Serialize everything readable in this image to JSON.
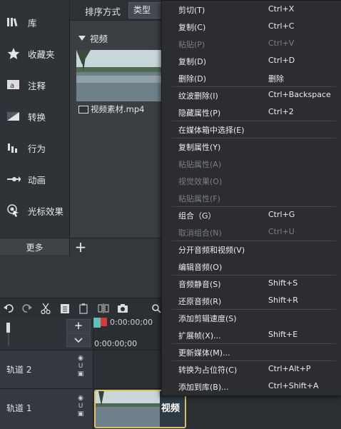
{
  "sidebar": {
    "items": [
      {
        "label": "库",
        "icon": "library-icon"
      },
      {
        "label": "收藏夹",
        "icon": "star-icon"
      },
      {
        "label": "注释",
        "icon": "annotation-icon"
      },
      {
        "label": "转换",
        "icon": "transition-icon"
      },
      {
        "label": "行为",
        "icon": "behavior-icon"
      },
      {
        "label": "动画",
        "icon": "animation-icon"
      },
      {
        "label": "光标效果",
        "icon": "cursor-effect-icon"
      }
    ],
    "more_label": "更多"
  },
  "media": {
    "sort_label": "排序方式",
    "sort_value": "类型",
    "section_label": "视频",
    "file_name": "视频素材.mp4"
  },
  "timeline": {
    "timecode_ruler": "0:00:00;00",
    "timecode_current": "0:00:00;00",
    "tracks": [
      {
        "name": "轨道 2"
      },
      {
        "name": "轨道 1"
      }
    ],
    "clip_label": "视频"
  },
  "context_menu": {
    "items": [
      {
        "label": "剪切(T)",
        "shortcut": "Ctrl+X",
        "enabled": true
      },
      {
        "label": "复制(C)",
        "shortcut": "Ctrl+C",
        "enabled": true
      },
      {
        "label": "粘贴(P)",
        "shortcut": "Ctrl+V",
        "enabled": false
      },
      {
        "label": "复制(D)",
        "shortcut": "Ctrl+D",
        "enabled": true
      },
      {
        "label": "删除(D)",
        "shortcut": "删除",
        "enabled": true
      },
      {
        "label": "纹波删除(I)",
        "shortcut": "Ctrl+Backspace",
        "enabled": true
      },
      {
        "label": "隐藏属性(P)",
        "shortcut": "Ctrl+2",
        "enabled": true
      },
      {
        "label": "在媒体箱中选择(E)",
        "shortcut": "",
        "enabled": true
      },
      {
        "label": "复制属性(Y)",
        "shortcut": "",
        "enabled": true
      },
      {
        "label": "粘贴属性(A)",
        "shortcut": "",
        "enabled": false
      },
      {
        "label": "视觉效果(O)",
        "shortcut": "",
        "enabled": false
      },
      {
        "label": "粘贴属性(F)",
        "shortcut": "",
        "enabled": false
      },
      {
        "label": "组合（G）",
        "shortcut": "Ctrl+G",
        "enabled": true
      },
      {
        "label": "取消组合(N)",
        "shortcut": "Ctrl+U",
        "enabled": false
      },
      {
        "label": "分开音频和视频(V)",
        "shortcut": "",
        "enabled": true
      },
      {
        "label": "编辑音频(O)",
        "shortcut": "",
        "enabled": true
      },
      {
        "label": "音频静音(S)",
        "shortcut": "Shift+S",
        "enabled": true
      },
      {
        "label": "还原音频(R)",
        "shortcut": "Shift+R",
        "enabled": true
      },
      {
        "label": "添加剪辑速度(S)",
        "shortcut": "",
        "enabled": true
      },
      {
        "label": "扩展帧(X)...",
        "shortcut": "Shift+E",
        "enabled": true
      },
      {
        "label": "更新媒体(M)...",
        "shortcut": "",
        "enabled": true
      },
      {
        "label": "转换为占位符(C)",
        "shortcut": "Ctrl+Alt+P",
        "enabled": true
      },
      {
        "label": "添加到库(B)...",
        "shortcut": "Ctrl+Shift+A",
        "enabled": true
      }
    ]
  }
}
